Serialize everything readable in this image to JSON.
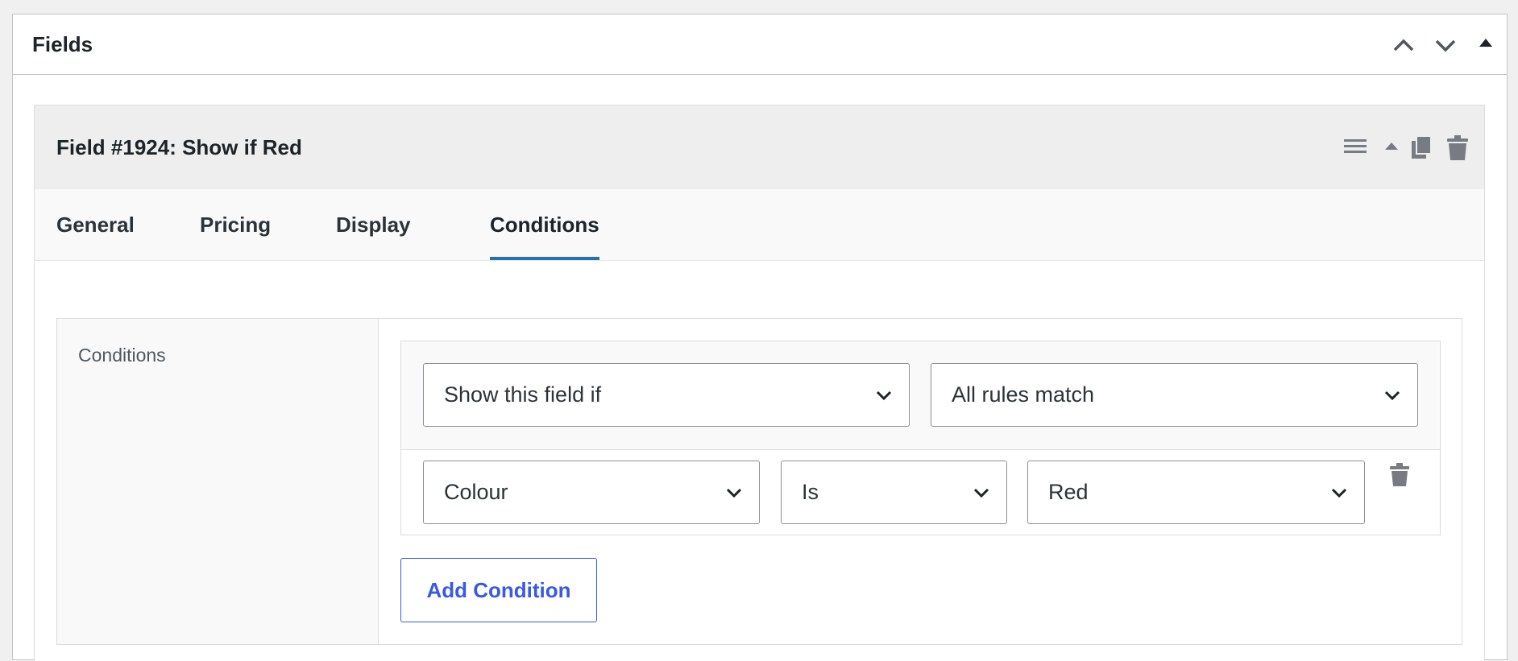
{
  "panel": {
    "title": "Fields",
    "icons": [
      "chevron-up-icon",
      "chevron-down-icon",
      "toggle-triangle-icon"
    ]
  },
  "field": {
    "title": "Field #1924: Show if Red",
    "icons": [
      "drag-handle-icon",
      "collapse-triangle-icon",
      "duplicate-icon",
      "trash-icon"
    ],
    "tabs": [
      {
        "label": "General"
      },
      {
        "label": "Pricing"
      },
      {
        "label": "Display"
      },
      {
        "label": "Conditions",
        "active": true
      }
    ]
  },
  "conditions": {
    "section_label": "Conditions",
    "visibility_select": "Show this field if",
    "match_select": "All rules match",
    "rules": [
      {
        "attribute": "Colour",
        "operator": "Is",
        "value": "Red"
      }
    ],
    "add_button": "Add Condition"
  },
  "colors": {
    "accent": "#2271b1",
    "button_blue": "#3858e9",
    "header_bg": "#eeeeee",
    "icon_gray": "#787c82"
  }
}
